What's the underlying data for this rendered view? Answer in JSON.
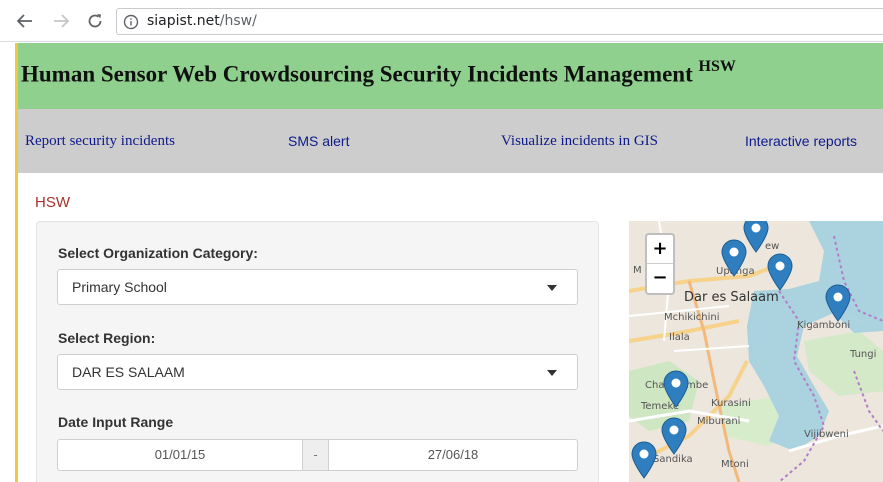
{
  "browser": {
    "url_host": "siapist.net",
    "url_path": "/hsw/"
  },
  "app": {
    "title": "Human Sensor Web Crowdsourcing Security Incidents Management",
    "title_sup": "HSW",
    "header_color": "#8fd08f",
    "nav": [
      {
        "label": "Report security incidents"
      },
      {
        "label": "SMS alert"
      },
      {
        "label": "Visualize incidents in GIS"
      },
      {
        "label": "Interactive reports"
      }
    ],
    "page_heading": "HSW"
  },
  "form": {
    "org_category_label": "Select Organization Category:",
    "org_category_value": "Primary School",
    "region_label": "Select Region:",
    "region_value": "DAR ES SALAAM",
    "date_range_label": "Date Input Range",
    "date_start": "01/01/15",
    "date_separator": "-",
    "date_end": "27/06/18"
  },
  "map": {
    "zoom_in": "+",
    "zoom_out": "−",
    "marker_color": "#2f7fc0",
    "labels": {
      "mw": "M",
      "ew": "ew",
      "upanga": "Upanga",
      "city": "Dar es Salaam",
      "mchikichini": "Mchikichini",
      "ilala": "Ilala",
      "kigamboni": "Kigamboni",
      "tungi": "Tungi",
      "chang": "Chang'ombe",
      "temeke": "Temeke",
      "kurasini": "Kurasini",
      "miburani": "Miburani",
      "vijibweni": "Vijibweni",
      "mtoni": "Mtoni",
      "sandika": "Sandika"
    }
  }
}
